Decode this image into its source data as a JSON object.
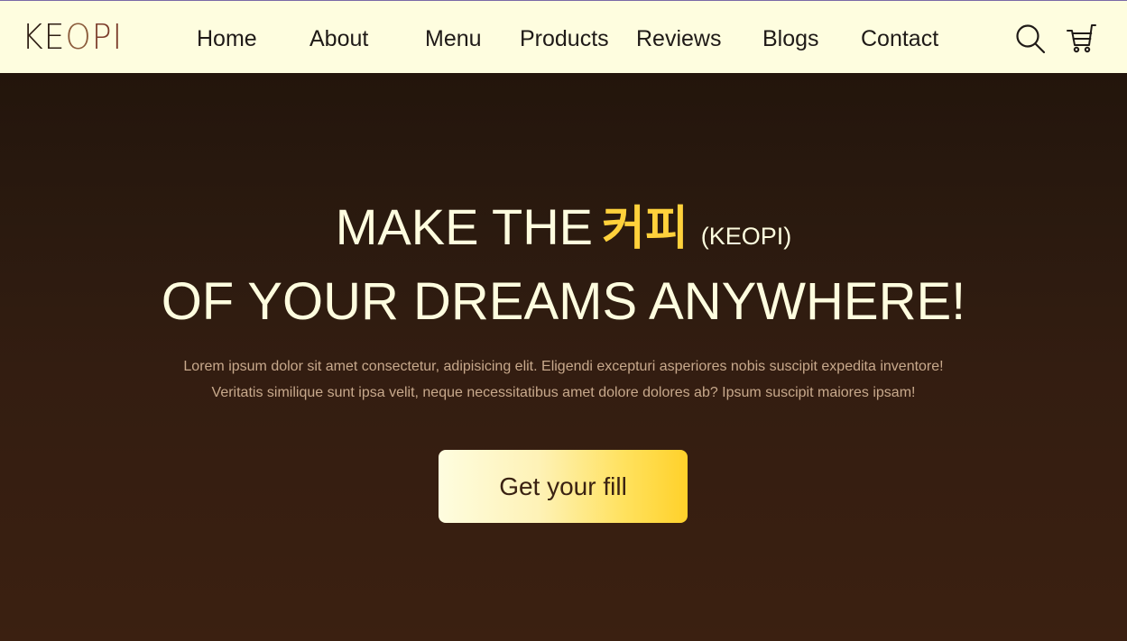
{
  "header": {
    "logo": {
      "part1": "KE",
      "part2": "O",
      "part3": "PI"
    },
    "nav": [
      {
        "label": "Home"
      },
      {
        "label": "About"
      },
      {
        "label": "Menu"
      },
      {
        "label": "Products"
      },
      {
        "label": "Reviews"
      },
      {
        "label": "Blogs"
      },
      {
        "label": "Contact"
      }
    ],
    "icons": {
      "search": "search-icon",
      "cart": "cart-icon"
    }
  },
  "hero": {
    "line1": {
      "prefix": "MAKE THE",
      "korean": "커피",
      "romanized": "(KEOPI)"
    },
    "line2": "OF YOUR DREAMS ANYWHERE!",
    "paragraph": {
      "line1": "Lorem ipsum dolor sit amet consectetur, adipisicing elit. Eligendi excepturi asperiores nobis suscipit expedita inventore!",
      "line2": "Veritatis similique sunt ipsa velit, neque necessitatibus amet dolore dolores ab? Ipsum suscipit maiores ipsam!"
    },
    "cta": {
      "label": "Get your fill"
    }
  },
  "colors": {
    "header_bg": "#fefddf",
    "hero_bg_top": "#23150c",
    "hero_bg_bottom": "#3b2011",
    "hero_text": "#fefddf",
    "accent_yellow": "#ffd13b",
    "paragraph_text": "#c8a98c",
    "button_text": "#3a2212"
  }
}
